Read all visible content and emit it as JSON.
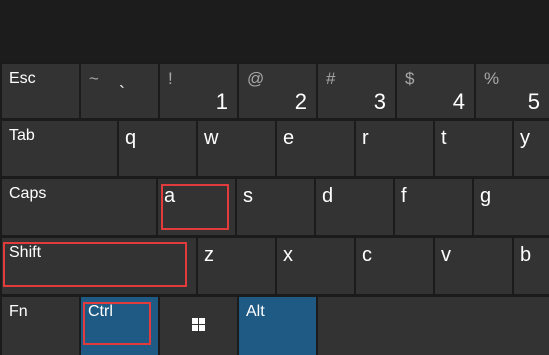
{
  "row_function": {
    "esc": "Esc"
  },
  "row_numbers": [
    {
      "shift": "~",
      "main": "`"
    },
    {
      "shift": "!",
      "main": "1"
    },
    {
      "shift": "@",
      "main": "2"
    },
    {
      "shift": "#",
      "main": "3"
    },
    {
      "shift": "$",
      "main": "4"
    },
    {
      "shift": "%",
      "main": "5"
    }
  ],
  "row_tab": {
    "tab": "Tab",
    "keys": [
      "q",
      "w",
      "e",
      "r",
      "t",
      "y"
    ]
  },
  "row_caps": {
    "caps": "Caps",
    "keys": [
      "a",
      "s",
      "d",
      "f",
      "g"
    ]
  },
  "row_shift": {
    "shift": "Shift",
    "keys": [
      "z",
      "x",
      "c",
      "v",
      "b"
    ]
  },
  "row_bottom": {
    "fn": "Fn",
    "ctrl": "Ctrl",
    "win_icon": "windows-logo-icon",
    "alt": "Alt"
  },
  "colors": {
    "key_background": "#333333",
    "accent_key": "#1f5a85",
    "highlight_border": "#e23b3b",
    "keyboard_background": "#1b1b1b"
  },
  "highlighted_keys": [
    "a",
    "Shift",
    "Ctrl"
  ]
}
